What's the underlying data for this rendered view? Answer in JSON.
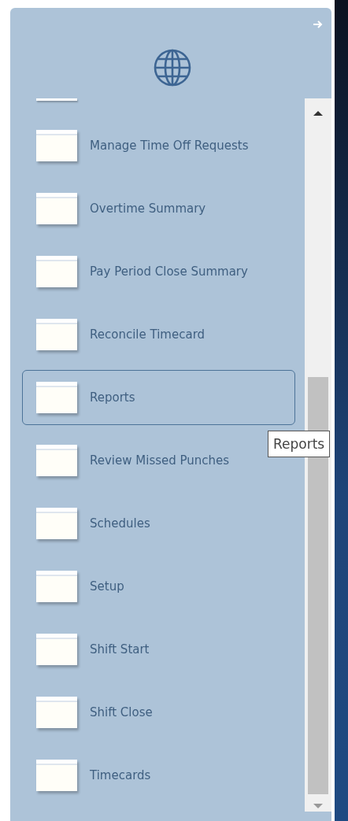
{
  "menu": {
    "items": [
      {
        "label": "Manage Time Off Requests",
        "selected": false
      },
      {
        "label": "Overtime Summary",
        "selected": false
      },
      {
        "label": "Pay Period Close Summary",
        "selected": false
      },
      {
        "label": "Reconcile Timecard",
        "selected": false
      },
      {
        "label": "Reports",
        "selected": true
      },
      {
        "label": "Review Missed Punches",
        "selected": false
      },
      {
        "label": "Schedules",
        "selected": false
      },
      {
        "label": "Setup",
        "selected": false
      },
      {
        "label": "Shift Start",
        "selected": false
      },
      {
        "label": "Shift Close",
        "selected": false
      },
      {
        "label": "Timecards",
        "selected": false
      }
    ]
  },
  "tooltip": {
    "text": "Reports"
  }
}
